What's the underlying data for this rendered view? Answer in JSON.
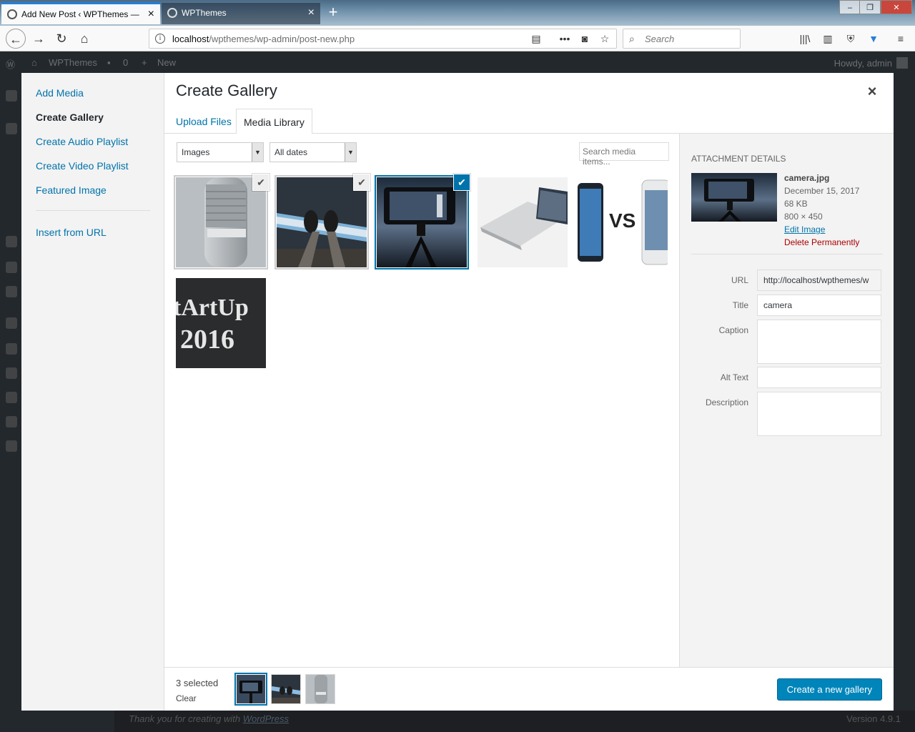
{
  "browser": {
    "tabs": [
      {
        "title": "Add New Post ‹ WPThemes —"
      },
      {
        "title": "WPThemes"
      }
    ],
    "url": {
      "host": "localhost",
      "path": "/wpthemes/wp-admin/post-new.php"
    },
    "search_placeholder": "Search"
  },
  "adminbar": {
    "site": "WPThemes",
    "comments": "0",
    "new": "New",
    "howdy": "Howdy, admin"
  },
  "footer": {
    "thanks": "Thank you for creating with",
    "link": "WordPress",
    "version": "Version 4.9.1"
  },
  "menu": {
    "items": [
      {
        "label": "Add Media"
      },
      {
        "label": "Create Gallery"
      },
      {
        "label": "Create Audio Playlist"
      },
      {
        "label": "Create Video Playlist"
      },
      {
        "label": "Featured Image"
      }
    ],
    "insert_from_url": "Insert from URL"
  },
  "frame": {
    "title": "Create Gallery",
    "close": "×"
  },
  "router": {
    "upload": "Upload Files",
    "library": "Media Library"
  },
  "filters": {
    "type": "Images",
    "date": "All dates",
    "search_placeholder": "Search media items..."
  },
  "attachment": {
    "heading": "Attachment Details",
    "filename": "camera.jpg",
    "date": "December 15, 2017",
    "size": "68 KB",
    "dimensions": "800 × 450",
    "edit": "Edit Image",
    "delete": "Delete Permanently",
    "fields": {
      "url_label": "URL",
      "url_value": "http://localhost/wpthemes/w",
      "title_label": "Title",
      "title_value": "camera",
      "caption_label": "Caption",
      "alt_label": "Alt Text",
      "description_label": "Description"
    }
  },
  "selection": {
    "count": "3 selected",
    "clear": "Clear"
  },
  "primary_button": "Create a new gallery",
  "colors": {
    "accent": "#0073aa",
    "button": "#0085ba",
    "adminbar": "#23282d"
  }
}
